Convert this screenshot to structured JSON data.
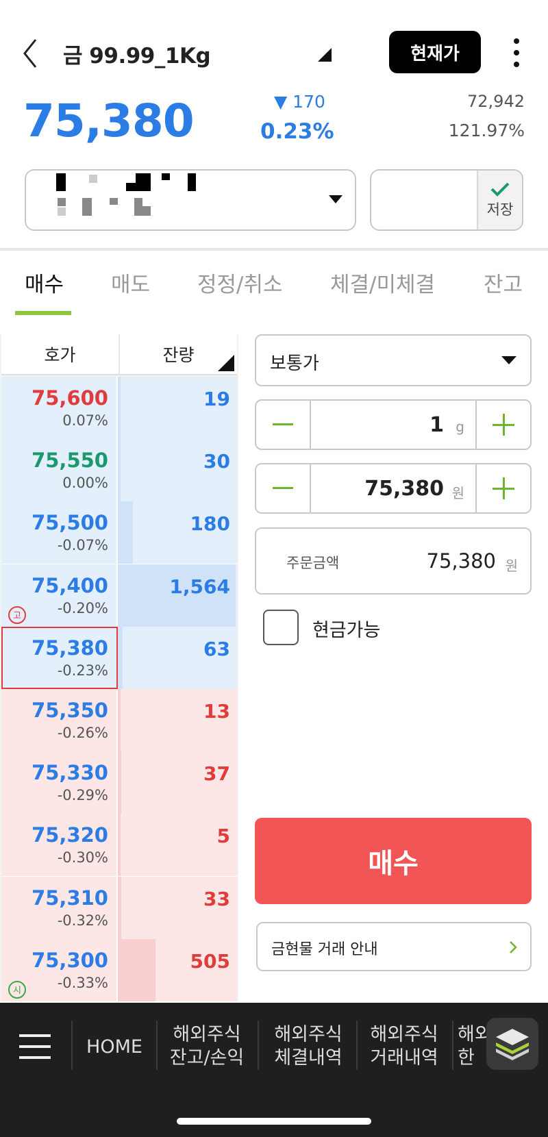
{
  "header": {
    "title": "금 99.99_1Kg",
    "current_price_button": "현재가"
  },
  "quote": {
    "price": "75,380",
    "change_abs": "▼ 170",
    "change_pct": "0.23%",
    "stat_1": "72,942",
    "stat_2": "121.97%"
  },
  "account": {
    "save_label": "저장"
  },
  "tabs": [
    {
      "label": "매수",
      "active": true
    },
    {
      "label": "매도"
    },
    {
      "label": "정정/취소"
    },
    {
      "label": "체결/미체결"
    },
    {
      "label": "잔고"
    }
  ],
  "orderbook": {
    "headers": [
      "호가",
      "잔량"
    ],
    "rows": [
      {
        "price": "75,600",
        "pct": "0.07%",
        "qty": "19",
        "side": "ask",
        "price_color": "#e03c3c",
        "bar": 0.02
      },
      {
        "price": "75,550",
        "pct": "0.00%",
        "qty": "30",
        "side": "ask",
        "price_color": "#1a9a6c",
        "bar": 0.02
      },
      {
        "price": "75,500",
        "pct": "-0.07%",
        "qty": "180",
        "side": "ask",
        "price_color": "#2c7ce6",
        "bar": 0.13
      },
      {
        "price": "75,400",
        "pct": "-0.20%",
        "qty": "1,564",
        "side": "ask",
        "price_color": "#2c7ce6",
        "bar": 1.0,
        "badge": "고",
        "badge_color": "#e03c3c"
      },
      {
        "price": "75,380",
        "pct": "-0.23%",
        "qty": "63",
        "side": "ask",
        "price_color": "#2c7ce6",
        "bar": 0.04,
        "selected": true
      },
      {
        "price": "75,350",
        "pct": "-0.26%",
        "qty": "13",
        "side": "bid",
        "price_color": "#2c7ce6",
        "bar": 0.02
      },
      {
        "price": "75,330",
        "pct": "-0.29%",
        "qty": "37",
        "side": "bid",
        "price_color": "#2c7ce6",
        "bar": 0.03
      },
      {
        "price": "75,320",
        "pct": "-0.30%",
        "qty": "5",
        "side": "bid",
        "price_color": "#2c7ce6",
        "bar": 0.01
      },
      {
        "price": "75,310",
        "pct": "-0.32%",
        "qty": "33",
        "side": "bid",
        "price_color": "#2c7ce6",
        "bar": 0.03
      },
      {
        "price": "75,300",
        "pct": "-0.33%",
        "qty": "505",
        "side": "bid",
        "price_color": "#2c7ce6",
        "bar": 0.32,
        "badge": "시",
        "badge_color": "#3aa845"
      }
    ]
  },
  "order": {
    "type": "보통가",
    "quantity": "1",
    "quantity_unit": "g",
    "price": "75,380",
    "price_unit": "원",
    "amount_label": "주문금액",
    "amount": "75,380",
    "amount_unit": "원",
    "cash_label": "현금가능",
    "buy_button": "매수",
    "guide": "금현물 거래 안내"
  },
  "bottom_nav": {
    "items": [
      {
        "line1": "HOME",
        "line2": ""
      },
      {
        "line1": "해외주식",
        "line2": "잔고/손익"
      },
      {
        "line1": "해외주식",
        "line2": "체결내역"
      },
      {
        "line1": "해외주식",
        "line2": "거래내역"
      },
      {
        "line1": "해외",
        "line2": "한"
      }
    ]
  },
  "colors": {
    "accent_green": "#8dc63f",
    "price_blue": "#2c7ce6",
    "buy_red": "#f25555"
  }
}
